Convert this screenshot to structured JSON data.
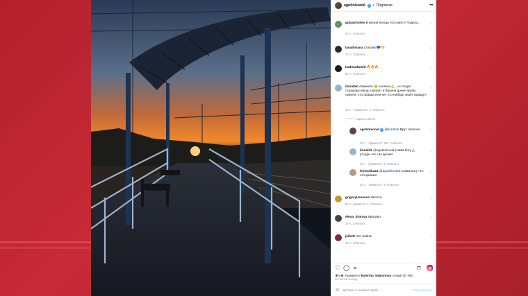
{
  "header": {
    "username": "agutinleonid",
    "verified_badge": "✓",
    "separator": "•",
    "follow_label": "Подписки",
    "more_label": "•••"
  },
  "comments": [
    {
      "user": "gulyashchev",
      "text": "В жизни всегда есть место Чудесу...",
      "time": "19 ч.",
      "reply": "Ответить",
      "avatar_color": "#6b8c6a"
    },
    {
      "user": "lanalilsiana",
      "text": "Спасибо💙💛",
      "time": "17 ч.",
      "reply": "Ответить",
      "avatar_color": "#2b2b2b"
    },
    {
      "user": "badmadwwld",
      "text": "🔥🔥🔥",
      "time": "20 ч.",
      "reply": "Ответить",
      "avatar_color": "#1a1a1a"
    },
    {
      "user": "ilonafok",
      "text": "Извините 😔 конечно🙏 , но такую страшную вещь говорят я Вашею дочке якобы смерти. это правда или нет кто-нибудь знает правду?",
      "time": "19 ч.",
      "likes": "\"Нравится\": 4",
      "reply": "Ответить",
      "avatar_color": "#9bb3c4"
    }
  ],
  "hide_replies_label": "Скрыть ответы",
  "replies": [
    {
      "user": "agutinleonid",
      "mention": "@ilonafok",
      "text": "Врут сволочи.",
      "time": "10 ч.",
      "likes": "\"Нравится\": 352",
      "reply": "Ответить",
      "avatar_color": "#5d4a44"
    },
    {
      "user": "ilonafok",
      "mention": "@agutinleonid",
      "text": "слава богу🙏 у*роды кто так делает",
      "time": "11 ч.",
      "likes": "\"Нравится\": 3",
      "reply": "Ответить",
      "avatar_color": "#9bb3c4"
    },
    {
      "user": "leylochka21",
      "mention": "@agutinleonid",
      "text": "слава Богу что это вранье!",
      "time": "10 ч.",
      "likes": "\"Нравится\": 9",
      "reply": "Ответить",
      "avatar_color": "#b89a8a"
    }
  ],
  "comments_after": [
    {
      "user": "grigorylavrenov",
      "text": "Липота.",
      "time": "20 ч.",
      "likes": "Нравится: 1",
      "reply": "Ответить",
      "avatar_color": "#c49a2a"
    },
    {
      "user": "elena_dratova",
      "text": "Красиво",
      "time": "19 ч.",
      "reply": "Ответить",
      "avatar_color": "#3b4a3a"
    },
    {
      "user": "julleitt",
      "text": "Нет войне!",
      "time": "18 ч.",
      "reply": "Ответить",
      "avatar_color": "#7a2a4a"
    }
  ],
  "actions": {
    "like_icon": "♡",
    "comment_icon": "◯",
    "share_icon": "➢",
    "save_icon": "⊓"
  },
  "likes": {
    "prefix": "Нравится",
    "user": "katerina_kalyonova",
    "suffix": "и ещё 10 783"
  },
  "posted_time": "20 ЧАСОВ НАЗАД",
  "add_comment": {
    "emoji": "☺",
    "placeholder": "Добавьте комментарий...",
    "publish": "Опубликовать"
  }
}
